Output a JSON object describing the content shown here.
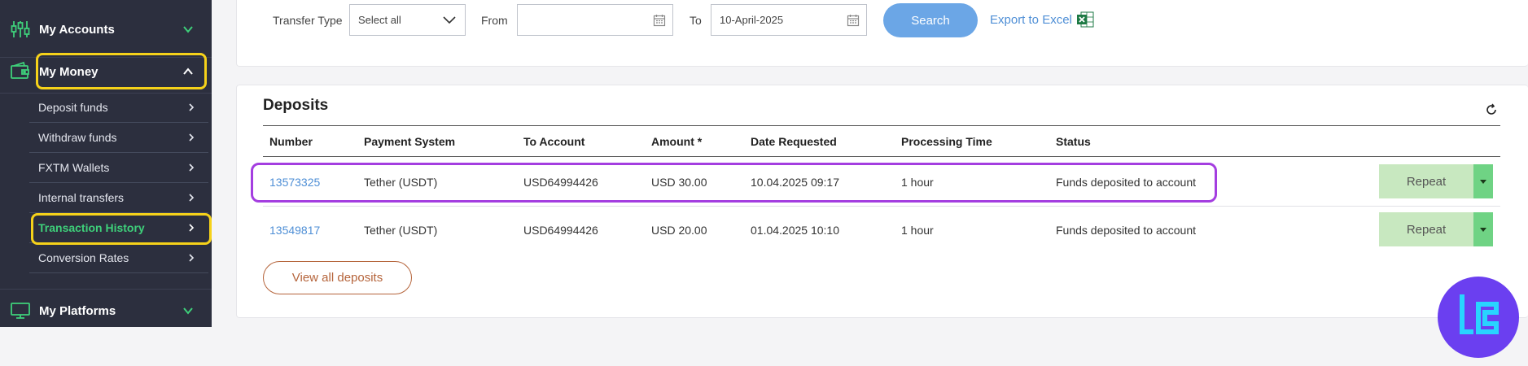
{
  "sidebar": {
    "my_accounts": "My Accounts",
    "my_money": "My Money",
    "items": [
      {
        "label": "Deposit funds"
      },
      {
        "label": "Withdraw funds"
      },
      {
        "label": "FXTM Wallets"
      },
      {
        "label": "Internal transfers"
      },
      {
        "label": "Transaction History"
      },
      {
        "label": "Conversion Rates"
      }
    ],
    "my_platforms": "My Platforms"
  },
  "filters": {
    "transfer_type_label": "Transfer Type",
    "transfer_type_value": "Select all",
    "from_label": "From",
    "from_value": "",
    "to_label": "To",
    "to_value": "10-April-2025",
    "search_label": "Search",
    "export_label": "Export to Excel"
  },
  "deposits": {
    "title": "Deposits",
    "columns": [
      "Number",
      "Payment System",
      "To Account",
      "Amount *",
      "Date Requested",
      "Processing Time",
      "Status"
    ],
    "rows": [
      {
        "number": "13573325",
        "payment_system": "Tether (USDT)",
        "to_account": "USD64994426",
        "amount": "USD 30.00",
        "date": "10.04.2025 09:17",
        "processing": "1 hour",
        "status": "Funds deposited to account"
      },
      {
        "number": "13549817",
        "payment_system": "Tether (USDT)",
        "to_account": "USD64994426",
        "amount": "USD 20.00",
        "date": "01.04.2025 10:10",
        "processing": "1 hour",
        "status": "Funds deposited to account"
      }
    ],
    "repeat_label": "Repeat",
    "view_all_label": "View all deposits"
  },
  "colors": {
    "sidebar_bg": "#2c2f3e",
    "accent_green": "#3ed07a",
    "highlight_yellow": "#f6d21a",
    "highlight_purple": "#a43ee0",
    "search_blue": "#6ba6e6"
  }
}
